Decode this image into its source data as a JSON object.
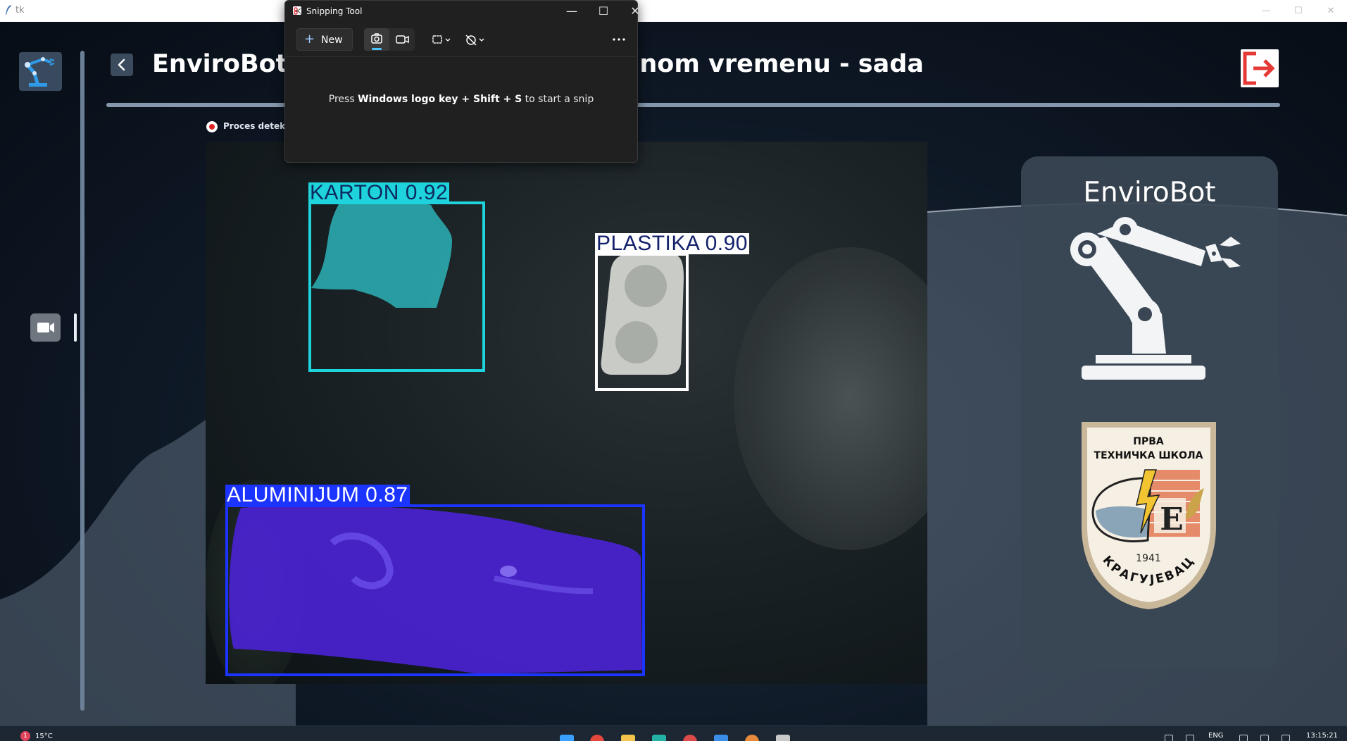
{
  "window": {
    "title": "tk"
  },
  "header": {
    "title": "EnviroBot - Detekcija otpada u realnom vremenu - sada"
  },
  "status": {
    "process_label": "Proces detekcije"
  },
  "detections": [
    {
      "label": "KARTON  0.92",
      "color": "#1fd3dc"
    },
    {
      "label": "PLASTIKA  0.90",
      "color": "#ffffff"
    },
    {
      "label": "ALUMINIJUM  0.87",
      "color": "#1b34ff"
    }
  ],
  "side_panel": {
    "brand": "EnviroBot",
    "emblem": {
      "top": "ПРВА",
      "name": "ТЕХНИЧКА ШКОЛА",
      "year": "1941",
      "city": "КРАГУЈЕВАЦ"
    }
  },
  "snipping_tool": {
    "title": "Snipping Tool",
    "new_label": "New",
    "hint_prefix": "Press ",
    "hint_keys": "Windows logo key + Shift + S",
    "hint_suffix": " to start a snip"
  },
  "taskbar": {
    "badge": "1",
    "weather": "15°C",
    "language": "ENG",
    "time": "13:15:21"
  },
  "colors": {
    "accent": "#4cc2ff",
    "logout": "#e53935",
    "panel": "#3a4654"
  }
}
